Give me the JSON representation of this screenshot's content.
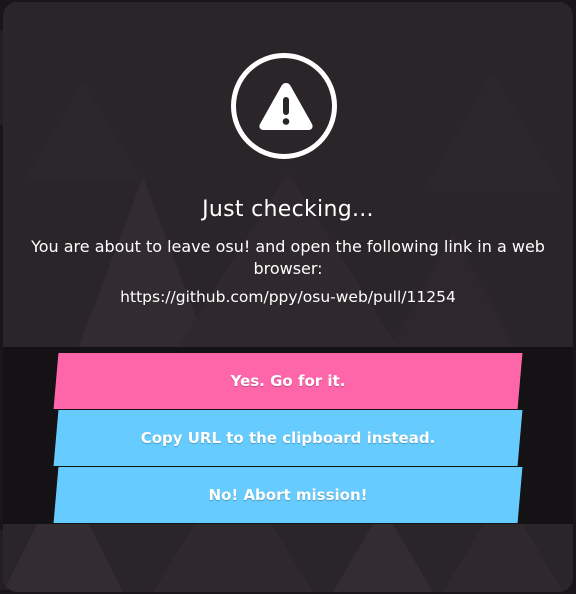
{
  "dialog": {
    "title": "Just checking...",
    "message": "You are about to leave osu! and open the following link in a web browser:",
    "link": "https://github.com/ppy/osu-web/pull/11254"
  },
  "buttons": {
    "yes_label": "Yes. Go for it.",
    "copy_label": "Copy URL to the clipboard instead.",
    "no_label": "No! Abort mission!"
  },
  "icons": {
    "warning": "warning-triangle-icon"
  },
  "colors": {
    "dialog_bg": "#2a2529",
    "button_band_bg": "#151215",
    "yes_button": "#ff66aa",
    "copy_button": "#66ccff",
    "no_button": "#66ccff",
    "text": "#ffffff"
  }
}
